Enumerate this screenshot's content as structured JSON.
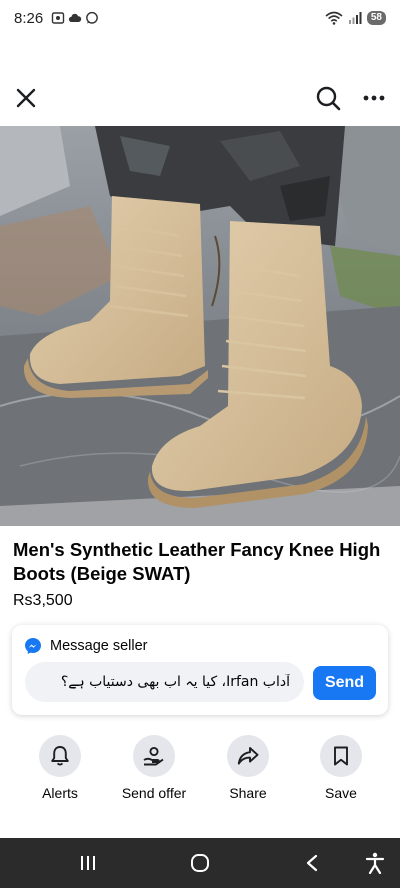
{
  "status_bar": {
    "time": "8:26",
    "battery": "58",
    "left_icons": [
      "screenshot-icon",
      "cloud-icon",
      "whatsapp-icon"
    ],
    "right_icons": [
      "wifi-icon",
      "signal-icon",
      "battery-icon"
    ]
  },
  "top_bar": {
    "icons": [
      "close-icon",
      "search-icon",
      "more-icon"
    ]
  },
  "product": {
    "title": "Men's Synthetic Leather Fancy Knee High Boots (Beige SWAT)",
    "price": "Rs3,500"
  },
  "message_card": {
    "heading": "Message seller",
    "input_value": "آداب Irfan، کیا یہ اب بھی دستیاب ہے؟",
    "send_label": "Send"
  },
  "actions": [
    {
      "label": "Alerts",
      "icon": "bell-icon"
    },
    {
      "label": "Send offer",
      "icon": "offer-icon"
    },
    {
      "label": "Share",
      "icon": "share-icon"
    },
    {
      "label": "Save",
      "icon": "bookmark-icon"
    }
  ],
  "nav_bar": {
    "icons": [
      "recents-icon",
      "home-icon",
      "back-icon",
      "accessibility-icon"
    ]
  },
  "colors": {
    "accent": "#1877f2",
    "nav_background": "#2b2b2b",
    "action_circle": "#e4e6eb",
    "input_background": "#f0f2f5"
  }
}
